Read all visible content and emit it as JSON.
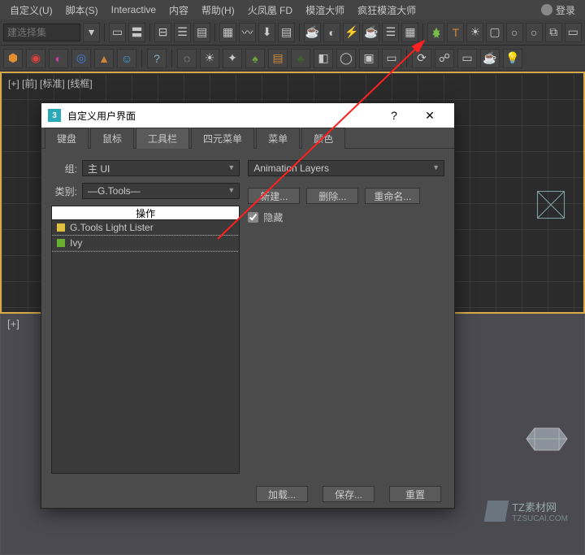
{
  "menu": {
    "customize": "自定义(U)",
    "script": "脚本(S)",
    "interactive": "Interactive",
    "content": "内容",
    "help": "帮助(H)",
    "phoenix": "火凤凰 FD",
    "render_master": "模渲大师",
    "crazy_render": "疯狂模渲大师"
  },
  "login": {
    "label": "登录"
  },
  "selection_set_placeholder": "建选择集",
  "viewport1": {
    "label": "[+] [前] [标准] [线框]"
  },
  "viewport2": {
    "label": "[+]"
  },
  "dialog": {
    "title": "自定义用户界面",
    "tabs": {
      "keyboard": "键盘",
      "mouse": "鼠标",
      "toolbar": "工具栏",
      "quad": "四元菜单",
      "menu": "菜单",
      "color": "颜色"
    },
    "group_label": "组:",
    "group_value": "主 UI",
    "category_label": "类别:",
    "category_value": "—G.Tools—",
    "toolbar_combo": "Animation Layers",
    "new_btn": "新建...",
    "delete_btn": "删除...",
    "rename_btn": "重命名...",
    "hide_label": "隐藏",
    "action_header": "操作",
    "actions": [
      {
        "icon": "y",
        "label": "G.Tools Light Lister"
      },
      {
        "icon": "g",
        "label": "Ivy"
      }
    ],
    "load_btn": "加载...",
    "save_btn": "保存...",
    "reset_btn": "重置"
  },
  "watermark": {
    "title": "TZ素材网",
    "sub": "TZSUCAI.COM"
  }
}
